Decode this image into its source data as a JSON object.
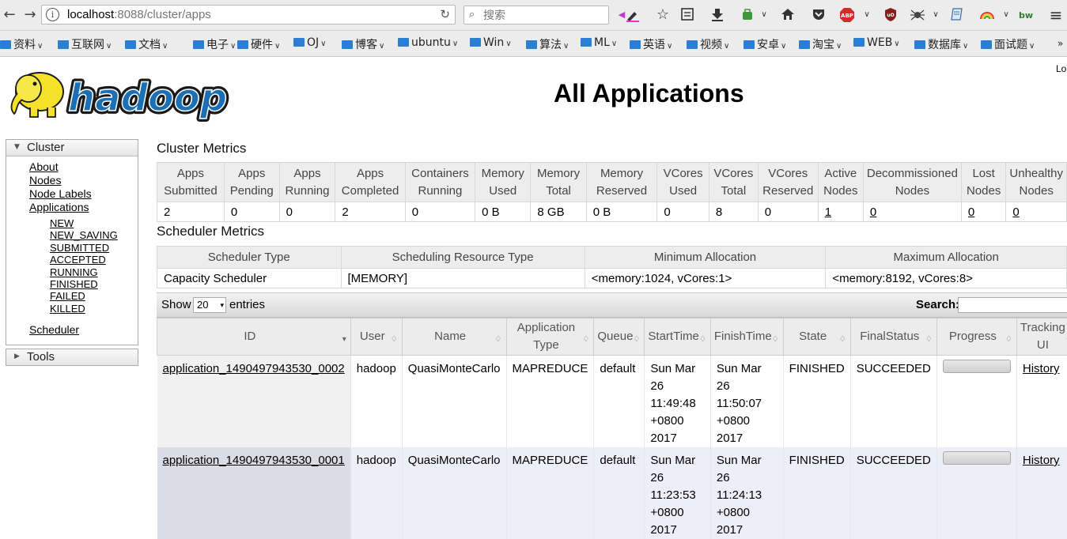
{
  "browser": {
    "url_host": "localhost",
    "url_rest": ":8088/cluster/apps",
    "search_placeholder": "搜索",
    "bookmarks": [
      "资料",
      "互联网",
      "文档",
      "电子",
      "硬件",
      "OJ",
      "博客",
      "ubuntu",
      "Win",
      "算法",
      "ML",
      "英语",
      "视频",
      "安卓",
      "淘宝",
      "WEB",
      "数据库",
      "面试题"
    ],
    "bookmarks_overflow": "»",
    "toolbar_icons": [
      "highlighter-icon",
      "bookmark-star-icon",
      "reading-list-icon",
      "download-icon",
      "extension-icon",
      "home-icon",
      "pocket-icon",
      "adblock-icon",
      "ublock-icon",
      "spider-icon",
      "notes-icon",
      "rainbow-icon",
      "bw-icon",
      "menu-icon"
    ]
  },
  "page": {
    "title": "All Applications",
    "login_fragment": "Lo"
  },
  "sidebar": {
    "cluster_title": "Cluster",
    "links": [
      "About",
      "Nodes",
      "Node Labels",
      "Applications"
    ],
    "app_states": [
      "NEW",
      "NEW_SAVING",
      "SUBMITTED",
      "ACCEPTED",
      "RUNNING",
      "FINISHED",
      "FAILED",
      "KILLED"
    ],
    "scheduler_link": "Scheduler",
    "tools_title": "Tools"
  },
  "cluster_metrics": {
    "title": "Cluster Metrics",
    "headers": [
      [
        "Apps",
        "Submitted"
      ],
      [
        "Apps",
        "Pending"
      ],
      [
        "Apps",
        "Running"
      ],
      [
        "Apps",
        "Completed"
      ],
      [
        "Containers",
        "Running"
      ],
      [
        "Memory",
        "Used"
      ],
      [
        "Memory",
        "Total"
      ],
      [
        "Memory",
        "Reserved"
      ],
      [
        "VCores",
        "Used"
      ],
      [
        "VCores",
        "Total"
      ],
      [
        "VCores",
        "Reserved"
      ],
      [
        "Active",
        "Nodes"
      ],
      [
        "Decommissioned",
        "Nodes"
      ],
      [
        "Lost",
        "Nodes"
      ],
      [
        "Unhealthy",
        "Nodes"
      ]
    ],
    "values": [
      "2",
      "0",
      "0",
      "2",
      "0",
      "0 B",
      "8 GB",
      "0 B",
      "0",
      "8",
      "0",
      "1",
      "0",
      "0",
      "0"
    ],
    "linked": [
      false,
      false,
      false,
      false,
      false,
      false,
      false,
      false,
      false,
      false,
      false,
      true,
      true,
      true,
      true
    ]
  },
  "scheduler_metrics": {
    "title": "Scheduler Metrics",
    "headers": [
      "Scheduler Type",
      "Scheduling Resource Type",
      "Minimum Allocation",
      "Maximum Allocation"
    ],
    "values": [
      "Capacity Scheduler",
      "[MEMORY]",
      "<memory:1024, vCores:1>",
      "<memory:8192, vCores:8>"
    ]
  },
  "table_controls": {
    "show_label": "Show",
    "page_size": "20",
    "entries_label": "entries",
    "search_label": "Search:"
  },
  "apps_table": {
    "columns": [
      [
        "ID"
      ],
      [
        "User"
      ],
      [
        "Name"
      ],
      [
        "Application",
        "Type"
      ],
      [
        "Queue"
      ],
      [
        "StartTime"
      ],
      [
        "FinishTime"
      ],
      [
        "State"
      ],
      [
        "FinalStatus"
      ],
      [
        "Progress"
      ],
      [
        "Tracking",
        "UI"
      ]
    ],
    "rows": [
      {
        "id": "application_1490497943530_0002",
        "user": "hadoop",
        "name": "QuasiMonteCarlo",
        "type": "MAPREDUCE",
        "queue": "default",
        "start_time": [
          "Sun Mar",
          "26",
          "11:49:48",
          "+0800",
          "2017"
        ],
        "finish_time": [
          "Sun Mar 26",
          "11:50:07",
          "+0800 2017"
        ],
        "state": "FINISHED",
        "final_status": "SUCCEEDED",
        "progress": 1.0,
        "tracking_ui": "History"
      },
      {
        "id": "application_1490497943530_0001",
        "user": "hadoop",
        "name": "QuasiMonteCarlo",
        "type": "MAPREDUCE",
        "queue": "default",
        "start_time": [
          "Sun Mar",
          "26",
          "11:23:53",
          "+0800",
          "2017"
        ],
        "finish_time": [
          "Sun Mar 26",
          "11:24:13",
          "+0800 2017"
        ],
        "state": "FINISHED",
        "final_status": "SUCCEEDED",
        "progress": 1.0,
        "tracking_ui": "History"
      }
    ]
  },
  "colors": {
    "logo_yellow": "#f5e12a",
    "logo_blue": "#1a6fb5",
    "bookmark_folder": "#2a7fd4"
  }
}
